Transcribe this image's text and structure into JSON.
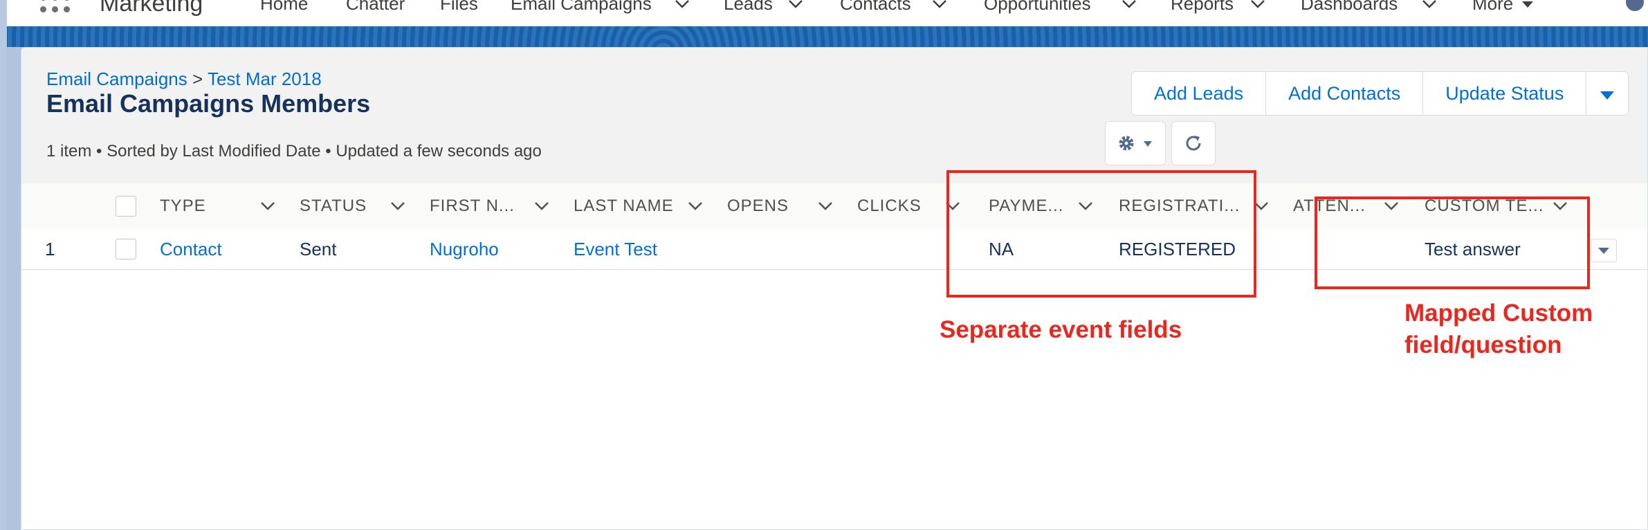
{
  "top_nav": {
    "app_name": "Marketing",
    "items": [
      {
        "label": "Home"
      },
      {
        "label": "Chatter"
      },
      {
        "label": "Files"
      },
      {
        "label": "Email Campaigns"
      },
      {
        "label": "Leads"
      },
      {
        "label": "Contacts"
      },
      {
        "label": "Opportunities"
      },
      {
        "label": "Reports"
      },
      {
        "label": "Dashboards"
      },
      {
        "label": "More"
      }
    ]
  },
  "breadcrumb": {
    "parent": "Email Campaigns",
    "separator": ">",
    "current": "Test Mar 2018"
  },
  "page": {
    "title": "Email Campaigns Members",
    "meta": "1 item • Sorted by Last Modified Date • Updated a few seconds ago"
  },
  "actions": {
    "add_leads": "Add Leads",
    "add_contacts": "Add Contacts",
    "update_status": "Update Status"
  },
  "table": {
    "columns": [
      "TYPE",
      "STATUS",
      "FIRST N...",
      "LAST NAME",
      "OPENS",
      "CLICKS",
      "PAYME...",
      "REGISTRATI...",
      "ATTEN...",
      "CUSTOM TE..."
    ],
    "rows": [
      {
        "index": "1",
        "type": "Contact",
        "status": "Sent",
        "first_name": "Nugroho",
        "last_name": "Event Test",
        "opens": "",
        "clicks": "",
        "payment": "NA",
        "registration": "REGISTERED",
        "attendance": "",
        "custom": "Test answer"
      }
    ]
  },
  "annotations": {
    "separate_fields": "Separate event fields",
    "mapped_line1": "Mapped Custom",
    "mapped_line2": "field/question"
  },
  "colors": {
    "link": "#0070d2",
    "callout": "#e8271f",
    "brand_band": "#1b5fa6"
  }
}
